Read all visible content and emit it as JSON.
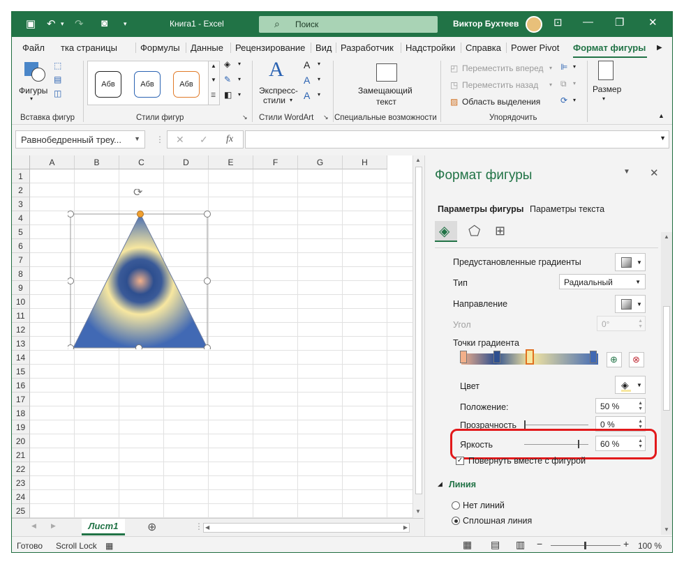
{
  "window": {
    "title": "Книга1  -  Excel",
    "search_label": "Поиск",
    "user": "Виктор Бухтеев"
  },
  "tabs": [
    "Файл",
    "Разметка страницы",
    "Формулы",
    "Данные",
    "Рецензирование",
    "Вид",
    "Разработчик",
    "Надстройки",
    "Справка",
    "Power Pivot",
    "Формат фигуры"
  ],
  "tabs_visible_cut": "тка страницы",
  "ribbon": {
    "shapes_label": "Фигуры",
    "insert_shapes_group": "Вставка фигур",
    "style_sample": "Абв",
    "shape_styles_group": "Стили фигур",
    "express_styles": "Экспресс-",
    "express_styles2": "стили",
    "wordart_group": "Стили WordArt",
    "alt_text": "Замещающий",
    "alt_text2": "текст",
    "accessibility_group": "Специальные возможности",
    "bring_forward": "Переместить вперед",
    "send_backward": "Переместить назад",
    "selection_pane": "Область выделения",
    "arrange_group": "Упорядочить",
    "size": "Размер"
  },
  "formula_bar": {
    "name_box": "Равнобедренный треу...",
    "fx": "fx",
    "formula": ""
  },
  "sheet": {
    "columns": [
      "A",
      "B",
      "C",
      "D",
      "E",
      "F",
      "G",
      "H"
    ],
    "rows": [
      "1",
      "2",
      "3",
      "4",
      "5",
      "6",
      "7",
      "8",
      "9",
      "10",
      "11",
      "12",
      "13",
      "14",
      "15",
      "16",
      "17",
      "18",
      "19",
      "20",
      "21",
      "22",
      "23",
      "24",
      "25"
    ],
    "active_sheet": "Лист1"
  },
  "status": {
    "ready": "Готово",
    "scroll_lock": "Scroll Lock",
    "zoom": "100 %"
  },
  "pane": {
    "title": "Формат фигуры",
    "tab_shape": "Параметры фигуры",
    "tab_text": "Параметры текста",
    "preset_gradients": "Предустановленные градиенты",
    "type_label": "Тип",
    "type_value": "Радиальный",
    "direction_label": "Направление",
    "angle_label": "Угол",
    "angle_value": "0°",
    "gradient_stops": "Точки градиента",
    "color_label": "Цвет",
    "position_label": "Положение:",
    "position_value": "50 %",
    "transparency_label": "Прозрачность",
    "transparency_value": "0 %",
    "brightness_label": "Яркость",
    "brightness_value": "60 %",
    "rotate_with_shape": "Повернуть вместе с фигурой",
    "line_section": "Линия",
    "no_line": "Нет линий",
    "solid_line": "Сплошная линия"
  }
}
